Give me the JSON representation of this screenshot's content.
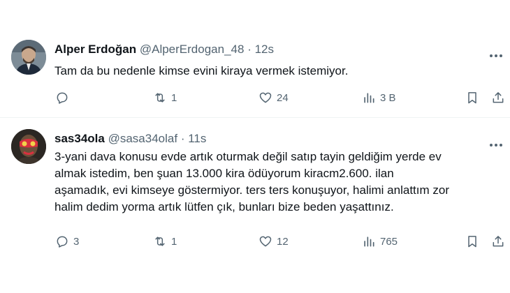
{
  "tweets": [
    {
      "name": "Alper Erdoğan",
      "handle": "@AlperErdogan_48",
      "separator": "·",
      "time": "12s",
      "text": "Tam da bu nedenle kimse evini kiraya vermek istemiyor.",
      "replies": "",
      "reposts": "1",
      "likes": "24",
      "views": "3 B"
    },
    {
      "name": "sas34ola",
      "handle": "@sasa34olaf",
      "separator": "·",
      "time": "11s",
      "text_lines": [
        "3-yani dava konusu evde artık oturmak değil satıp tayin geldiğim yerde ev",
        "almak istedim, ben şuan 13.000 kira ödüyorum kiracm2.600. ilan",
        "aşamadık, evi kimseye göstermiyor. ters ters konuşuyor, halimi anlattım zor",
        "halim dedim yorma artık lütfen çık, bunları bize beden yaşattınız."
      ],
      "replies": "3",
      "reposts": "1",
      "likes": "12",
      "views": "765"
    }
  ],
  "icons": {
    "reply": "reply-icon",
    "repost": "repost-icon",
    "like": "heart-icon",
    "views": "views-icon",
    "bookmark": "bookmark-icon",
    "share": "share-icon",
    "more": "more-dots-icon"
  },
  "colors": {
    "text": "#0f1419",
    "secondary": "#536471",
    "divider": "#eff3f4"
  }
}
